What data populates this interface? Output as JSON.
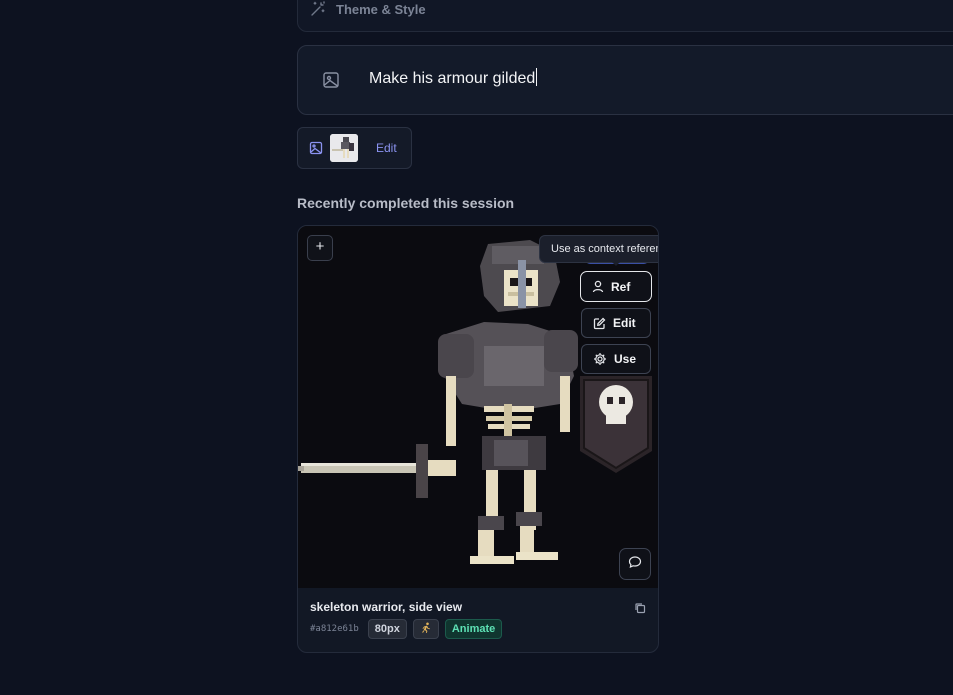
{
  "theme_panel": {
    "label": "Theme & Style",
    "icon": "magic-wand-icon"
  },
  "prompt": {
    "value": "Make his armour gilded",
    "icon": "image-icon"
  },
  "reference_chip": {
    "icon": "image-icon",
    "edit_label": "Edit"
  },
  "section": {
    "title": "Recently completed this session"
  },
  "card": {
    "add_label": "+",
    "tooltip": "Use as context reference",
    "actions": {
      "ref_label": "Ref",
      "edit_label": "Edit",
      "use_label": "Use"
    },
    "title": "skeleton warrior, side view",
    "hash": "#a812e61b",
    "size_badge": "80px",
    "runner_badge_icon": "running-figure-icon",
    "animate_label": "Animate"
  },
  "colors": {
    "background": "#0d1220",
    "accent": "#8b93f0",
    "animate_green": "#5de0b4"
  }
}
